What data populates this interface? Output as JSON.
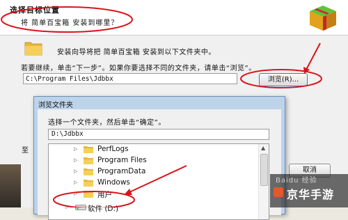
{
  "wizard": {
    "title": "选择目标位置",
    "subtitle": "将 简单百宝箱 安装到哪里？",
    "intro": "安装向导将把 简单百宝箱 安装到以下文件夹中。",
    "instruction": "若要继续，单击“下一步”。如果你要选择不同的文件夹，请单击“浏览”。",
    "install_path": "C:\\Program Files\\Jdbbx",
    "browse_label": "浏览(R)...",
    "space_label": "至",
    "cancel_label": "取消"
  },
  "browse_dialog": {
    "title": "浏览文件夹",
    "prompt": "选择一个文件夹，然后单击“确定”。",
    "path": "D:\\Jdbbx",
    "folders": [
      "PerfLogs",
      "Program Files",
      "ProgramData",
      "Windows",
      "用户"
    ],
    "drive_label": "软件 (D:)"
  },
  "watermark": {
    "sub": "Baidu 经验",
    "main": "京华手游"
  },
  "colors": {
    "annotation_red": "#d9141b",
    "folder_yellow": "#e8b83a",
    "button_border": "#3c7fb1"
  }
}
